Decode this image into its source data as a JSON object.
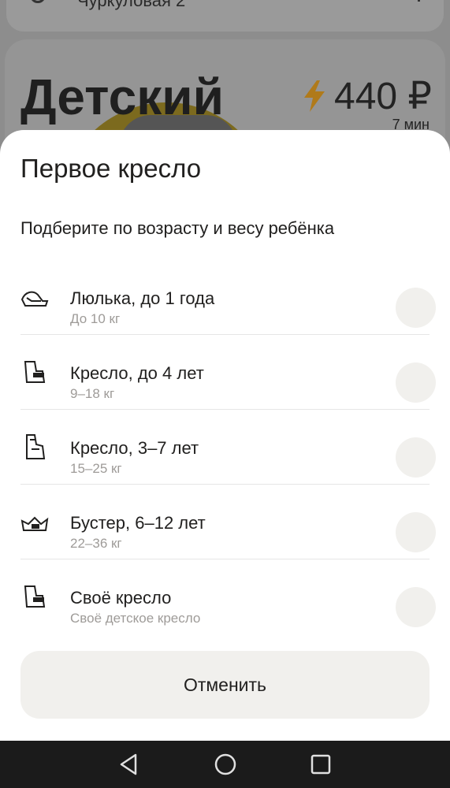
{
  "background": {
    "address": "Чуркуловая 2",
    "tariff_name": "Детский",
    "price": "440 ₽",
    "eta": "7 мин"
  },
  "sheet": {
    "title": "Первое кресло",
    "subtitle": "Подберите по возрасту и весу ребёнка",
    "options": [
      {
        "title": "Люлька, до 1 года",
        "subtitle": "До 10 кг",
        "icon": "infant-carrier-icon"
      },
      {
        "title": "Кресло, до 4 лет",
        "subtitle": "9–18 кг",
        "icon": "child-seat-icon"
      },
      {
        "title": "Кресло, 3–7 лет",
        "subtitle": "15–25 кг",
        "icon": "child-seat-highback-icon"
      },
      {
        "title": "Бустер, 6–12 лет",
        "subtitle": "22–36 кг",
        "icon": "booster-icon"
      },
      {
        "title": "Своё кресло",
        "subtitle": "Своё детское кресло",
        "icon": "own-seat-icon"
      }
    ],
    "cancel_label": "Отменить"
  },
  "colors": {
    "accent_bolt": "#f5a623",
    "radio_bg": "#f1f0ed",
    "subtext": "#9e9b98"
  }
}
